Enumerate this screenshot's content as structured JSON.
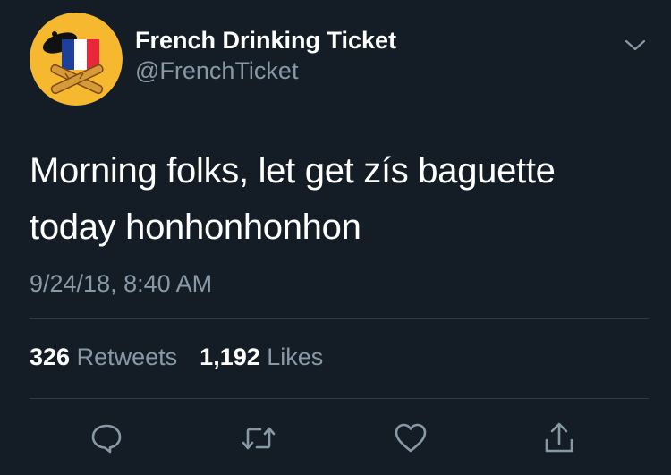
{
  "user": {
    "display_name": "French Drinking Ticket",
    "handle": "@FrenchTicket"
  },
  "tweet": {
    "text_line1": "Morning folks, let get zís baguette",
    "text_line2": "today honhonhonhon",
    "timestamp": "9/24/18, 8:40 AM"
  },
  "stats": {
    "retweets_count": "326",
    "retweets_label": "Retweets",
    "likes_count": "1,192",
    "likes_label": "Likes"
  },
  "icons": {
    "caret": "chevron-down-icon",
    "reply": "reply-icon",
    "retweet": "retweet-icon",
    "like": "heart-icon",
    "share": "share-icon"
  },
  "colors": {
    "background": "#141d26",
    "text": "#ffffff",
    "secondary_text": "#8899a6",
    "divider": "#2f3b47",
    "avatar_bg": "#f5b82e",
    "flag_blue": "#1f3f9a",
    "flag_white": "#ffffff",
    "flag_red": "#e8283a"
  }
}
